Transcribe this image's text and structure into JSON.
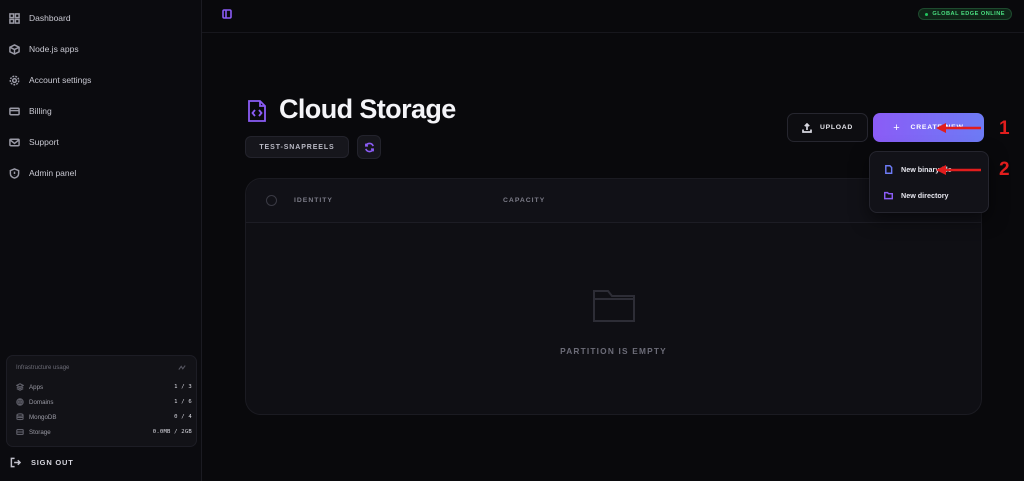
{
  "sidebar": {
    "items": [
      {
        "label": "Dashboard",
        "icon": "grid-icon"
      },
      {
        "label": "Node.js apps",
        "icon": "cube-icon"
      },
      {
        "label": "Account settings",
        "icon": "gear-icon"
      },
      {
        "label": "Billing",
        "icon": "credit-card-icon"
      },
      {
        "label": "Support",
        "icon": "mail-icon"
      },
      {
        "label": "Admin panel",
        "icon": "shield-icon"
      }
    ],
    "usage": {
      "title": "Infrastructure usage",
      "rows": [
        {
          "label": "Apps",
          "value": "1 / 3"
        },
        {
          "label": "Domains",
          "value": "1 / 6"
        },
        {
          "label": "MongoDB",
          "value": "0 / 4"
        },
        {
          "label": "Storage",
          "value": "0.0MB / 2GB"
        }
      ]
    },
    "signout_label": "SIGN OUT"
  },
  "topbar": {
    "status": "GLOBAL EDGE ONLINE",
    "status_color": "#22c55e"
  },
  "header": {
    "title": "Cloud Storage",
    "bucket": "TEST-SNAPREELS",
    "upload_label": "UPLOAD",
    "create_label": "CREATE NEW",
    "accent": "#8b5cf6"
  },
  "table": {
    "columns": [
      "IDENTITY",
      "CAPACITY"
    ],
    "empty_text": "PARTITION IS EMPTY"
  },
  "dropdown": {
    "items": [
      {
        "label": "New binary file",
        "icon": "file-icon",
        "color": "#6d7bf5"
      },
      {
        "label": "New directory",
        "icon": "folder-icon",
        "color": "#8b5cf6"
      }
    ]
  },
  "annotations": [
    "1",
    "2"
  ],
  "annotation_color": "#e11d1d"
}
